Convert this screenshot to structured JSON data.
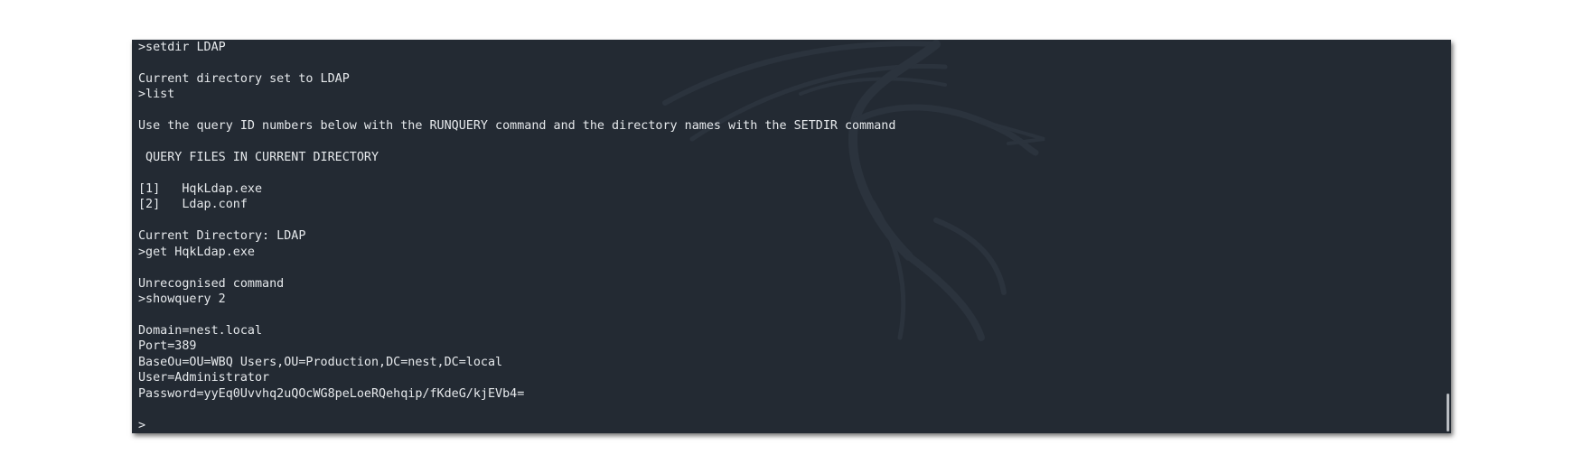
{
  "terminal": {
    "lines": [
      ">setdir LDAP",
      "",
      "Current directory set to LDAP",
      ">list",
      "",
      "Use the query ID numbers below with the RUNQUERY command and the directory names with the SETDIR command",
      "",
      " QUERY FILES IN CURRENT DIRECTORY",
      "",
      "[1]   HqkLdap.exe",
      "[2]   Ldap.conf",
      "",
      "Current Directory: LDAP",
      ">get HqkLdap.exe",
      "",
      "Unrecognised command",
      ">showquery 2",
      "",
      "Domain=nest.local",
      "Port=389",
      "BaseOu=OU=WBQ Users,OU=Production,DC=nest,DC=local",
      "User=Administrator",
      "Password=yyEq0Uvvhq2uQOcWG8peLoeRQehqip/fKdeG/kjEVb4=",
      "",
      ">"
    ]
  },
  "colors": {
    "background": "#232a33",
    "text": "#e6e9ec",
    "watermark": "#2d3540"
  },
  "icons": {
    "watermark": "kali-dragon-watermark-icon"
  }
}
